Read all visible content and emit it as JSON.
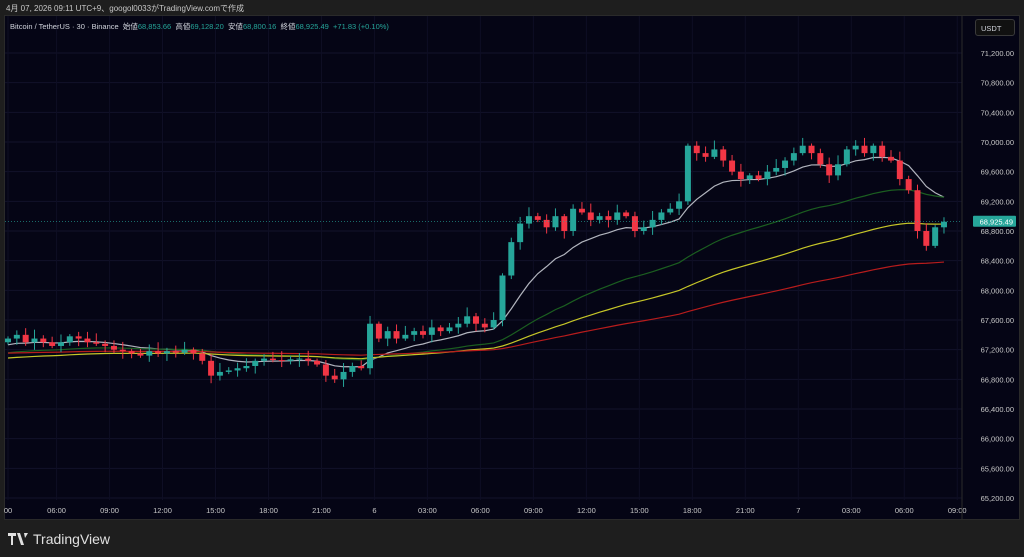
{
  "header": {
    "created": "4月 07, 2026 09:11 UTC+9、googol0033がTradingView.comで作成"
  },
  "legend": {
    "symbol": "Bitcoin / TetherUS · 30 · Binance",
    "open_label": "始値",
    "open": "68,853.66",
    "high_label": "高値",
    "high": "69,128.20",
    "low_label": "安値",
    "low": "68,800.16",
    "close_label": "終値",
    "close": "68,925.49",
    "change": "+71.83 (+0.10%)"
  },
  "currency_button": "USDT",
  "brand": "TradingView",
  "colors": {
    "up": "#26a69a",
    "down": "#f23645",
    "ma1": "#b2b5be",
    "ma2": "#1b5e20",
    "ma3": "#c6c628",
    "ma4": "#b71c1c",
    "bg": "#050515"
  },
  "chart_data": {
    "type": "candlestick",
    "interval": "30",
    "ylim": [
      65000,
      71500
    ],
    "y_ticks": [
      "71,200.00",
      "70,800.00",
      "70,400.00",
      "70,000.00",
      "69,600.00",
      "69,200.00",
      "68,800.00",
      "68,400.00",
      "68,000.00",
      "67,600.00",
      "67,200.00",
      "66,800.00",
      "66,400.00",
      "66,000.00",
      "65,600.00",
      "65,200.00"
    ],
    "y_tick_values": [
      71200,
      70800,
      70400,
      70000,
      69600,
      69200,
      68800,
      68400,
      68000,
      67600,
      67200,
      66800,
      66400,
      66000,
      65600,
      65200
    ],
    "x_ticks": [
      "00",
      "06:00",
      "09:00",
      "12:00",
      "15:00",
      "18:00",
      "21:00",
      "6",
      "03:00",
      "06:00",
      "09:00",
      "12:00",
      "15:00",
      "18:00",
      "21:00",
      "7",
      "03:00",
      "06:00",
      "09:00"
    ],
    "last_price": 68925.49,
    "last_price_label": "68,925.49",
    "first_open": 67300,
    "closes": [
      67350,
      67400,
      67300,
      67350,
      67300,
      67250,
      67300,
      67380,
      67350,
      67300,
      67280,
      67250,
      67200,
      67180,
      67150,
      67120,
      67180,
      67150,
      67180,
      67160,
      67200,
      67150,
      67050,
      66850,
      66900,
      66920,
      66950,
      66980,
      67050,
      67080,
      67060,
      67050,
      67070,
      67080,
      67050,
      67000,
      66850,
      66800,
      66900,
      66980,
      66950,
      67550,
      67350,
      67450,
      67350,
      67400,
      67450,
      67400,
      67500,
      67450,
      67500,
      67550,
      67650,
      67550,
      67500,
      67600,
      68200,
      68650,
      68900,
      69000,
      68950,
      68850,
      69000,
      68800,
      69100,
      69050,
      68950,
      69000,
      68950,
      69050,
      69000,
      68800,
      68850,
      68950,
      69050,
      69100,
      69200,
      69950,
      69850,
      69800,
      69900,
      69750,
      69600,
      69500,
      69550,
      69500,
      69600,
      69650,
      69750,
      69850,
      69950,
      69850,
      69700,
      69550,
      69700,
      69900,
      69950,
      69850,
      69950,
      69800,
      69750,
      69500,
      69350,
      68800,
      68600,
      68850,
      68925.49
    ],
    "moving_averages": [
      {
        "color": "#b2b5be",
        "period": 12,
        "seed": 67250
      },
      {
        "color": "#1b5e20",
        "period": 40,
        "seed": 67150
      },
      {
        "color": "#c6c628",
        "period": 70,
        "seed": 67080
      },
      {
        "color": "#b71c1c",
        "period": 130,
        "seed": 67150
      }
    ]
  }
}
